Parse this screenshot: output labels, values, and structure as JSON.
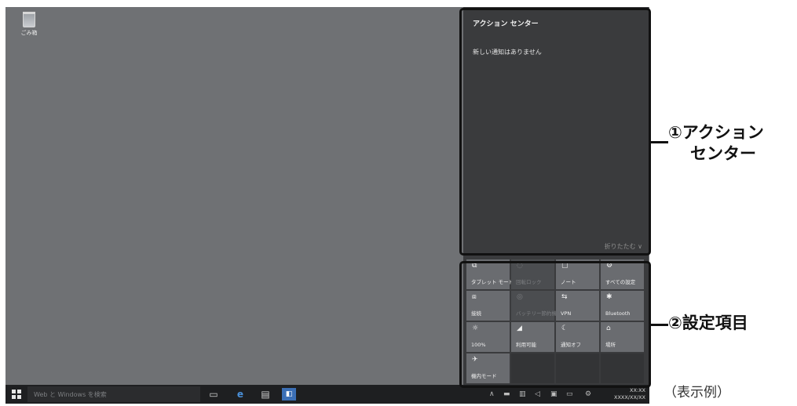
{
  "desktop": {
    "recycle_bin_label": "ごみ箱"
  },
  "action_center": {
    "title": "アクション センター",
    "empty_message": "新しい通知はありません",
    "collapse_label": "折りたたむ ∨"
  },
  "quick_actions": [
    {
      "icon": "tablet-mode-icon",
      "glyph": "⧉",
      "label": "タブレット モード",
      "state": "on"
    },
    {
      "icon": "rotation-lock-icon",
      "glyph": "◌",
      "label": "回転ロック",
      "state": "off"
    },
    {
      "icon": "note-icon",
      "glyph": "▢",
      "label": "ノート",
      "state": "on"
    },
    {
      "icon": "all-settings-icon",
      "glyph": "⚙",
      "label": "すべての設定",
      "state": "on"
    },
    {
      "icon": "connect-icon",
      "glyph": "⧈",
      "label": "接続",
      "state": "on"
    },
    {
      "icon": "battery-saver-icon",
      "glyph": "◎",
      "label": "バッテリー節約機能",
      "state": "off"
    },
    {
      "icon": "vpn-icon",
      "glyph": "⇆",
      "label": "VPN",
      "state": "on"
    },
    {
      "icon": "bluetooth-icon",
      "glyph": "✱",
      "label": "Bluetooth",
      "state": "on"
    },
    {
      "icon": "brightness-icon",
      "glyph": "☼",
      "label": "100%",
      "state": "on"
    },
    {
      "icon": "wifi-icon",
      "glyph": "◢",
      "label": "利用可能",
      "state": "on"
    },
    {
      "icon": "quiet-hours-icon",
      "glyph": "☾",
      "label": "通知オフ",
      "state": "on"
    },
    {
      "icon": "location-icon",
      "glyph": "⌂",
      "label": "場所",
      "state": "on"
    },
    {
      "icon": "airplane-mode-icon",
      "glyph": "✈",
      "label": "機内モード",
      "state": "on"
    }
  ],
  "taskbar": {
    "search_placeholder": "Web と Windows を検索",
    "clock_time": "XX:XX",
    "clock_date": "XXXX/XX/XX"
  },
  "callouts": {
    "action_center": "①アクション\nセンター",
    "settings": "②設定項目"
  },
  "note": "（表示例）",
  "colors": {
    "desktop": "#6f7174",
    "panel": "#3a3b3d",
    "taskbar": "#1e1f21",
    "tile": "#55575a",
    "highlight": "#111111"
  }
}
